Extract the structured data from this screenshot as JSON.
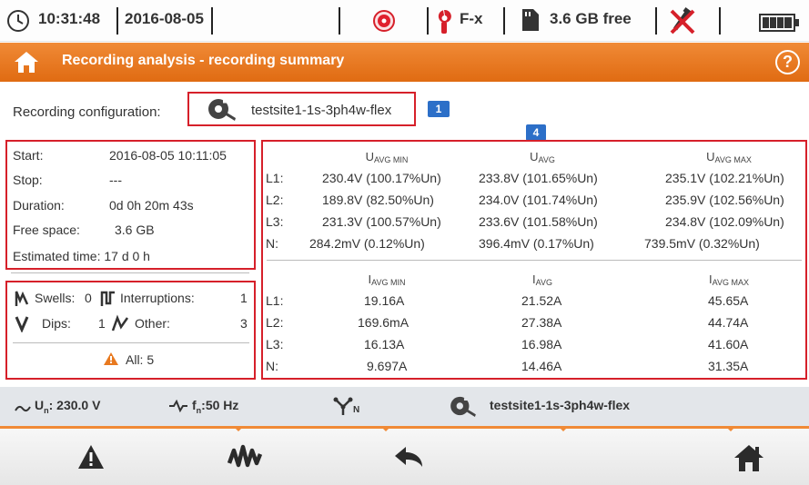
{
  "statusbar": {
    "time": "10:31:48",
    "date": "2016-08-05",
    "clamp": "F-x",
    "storage": "3.6 GB free"
  },
  "header": {
    "title": "Recording analysis - recording summary",
    "help": "?"
  },
  "config": {
    "label": "Recording configuration:",
    "name": "testsite1-1s-3ph4w-flex",
    "badge1": "1",
    "badge4": "4"
  },
  "summary": {
    "start_label": "Start:",
    "start_value": "2016-08-05 10:11:05",
    "stop_label": "Stop:",
    "stop_value": "---",
    "duration_label": "Duration:",
    "duration_value": "0d 0h 20m 43s",
    "free_label": "Free space:",
    "free_value": "3.6 GB",
    "estimated": "Estimated time: 17 d 0 h"
  },
  "events": {
    "swells_label": "Swells:",
    "swells": "0",
    "interruptions_label": "Interruptions:",
    "interruptions": "1",
    "dips_label": "Dips:",
    "dips": "1",
    "other_label": "Other:",
    "other": "3",
    "all": "All: 5"
  },
  "voltage": {
    "headers": [
      "U",
      "AVG MIN",
      "U",
      "AVG",
      "U",
      "AVG MAX"
    ],
    "rows": [
      {
        "label": "L1:",
        "min": "230.4V (100.17%Un)",
        "avg": "233.8V (101.65%Un)",
        "max": "235.1V (102.21%Un)"
      },
      {
        "label": "L2:",
        "min": "189.8V (82.50%Un)",
        "avg": "234.0V (101.74%Un)",
        "max": "235.9V (102.56%Un)"
      },
      {
        "label": "L3:",
        "min": "231.3V (100.57%Un)",
        "avg": "233.6V (101.58%Un)",
        "max": "234.8V (102.09%Un)"
      },
      {
        "label": "N:",
        "min": "284.2mV (0.12%Un)",
        "avg": "396.4mV (0.17%Un)",
        "max": "739.5mV (0.32%Un)"
      }
    ]
  },
  "current": {
    "headers": [
      "I",
      "AVG MIN",
      "I",
      "AVG",
      "I",
      "AVG MAX"
    ],
    "rows": [
      {
        "label": "L1:",
        "min": "19.16A",
        "avg": "21.52A",
        "max": "45.65A"
      },
      {
        "label": "L2:",
        "min": "169.6mA",
        "avg": "27.38A",
        "max": "44.74A"
      },
      {
        "label": "L3:",
        "min": "16.13A",
        "avg": "16.98A",
        "max": "41.60A"
      },
      {
        "label": "N:",
        "min": "9.697A",
        "avg": "14.46A",
        "max": "31.35A"
      }
    ]
  },
  "infobar": {
    "un_prefix": "U",
    "un_sub": "n",
    "un_value": ": 230.0 V",
    "fn_prefix": "f",
    "fn_sub": "n",
    "fn_value": ":50 Hz",
    "system_sub": "N",
    "config_name": "testsite1-1s-3ph4w-flex"
  },
  "colors": {
    "accent": "#e8791f",
    "highlight": "#d6202a",
    "badge": "#2c6fc8"
  }
}
